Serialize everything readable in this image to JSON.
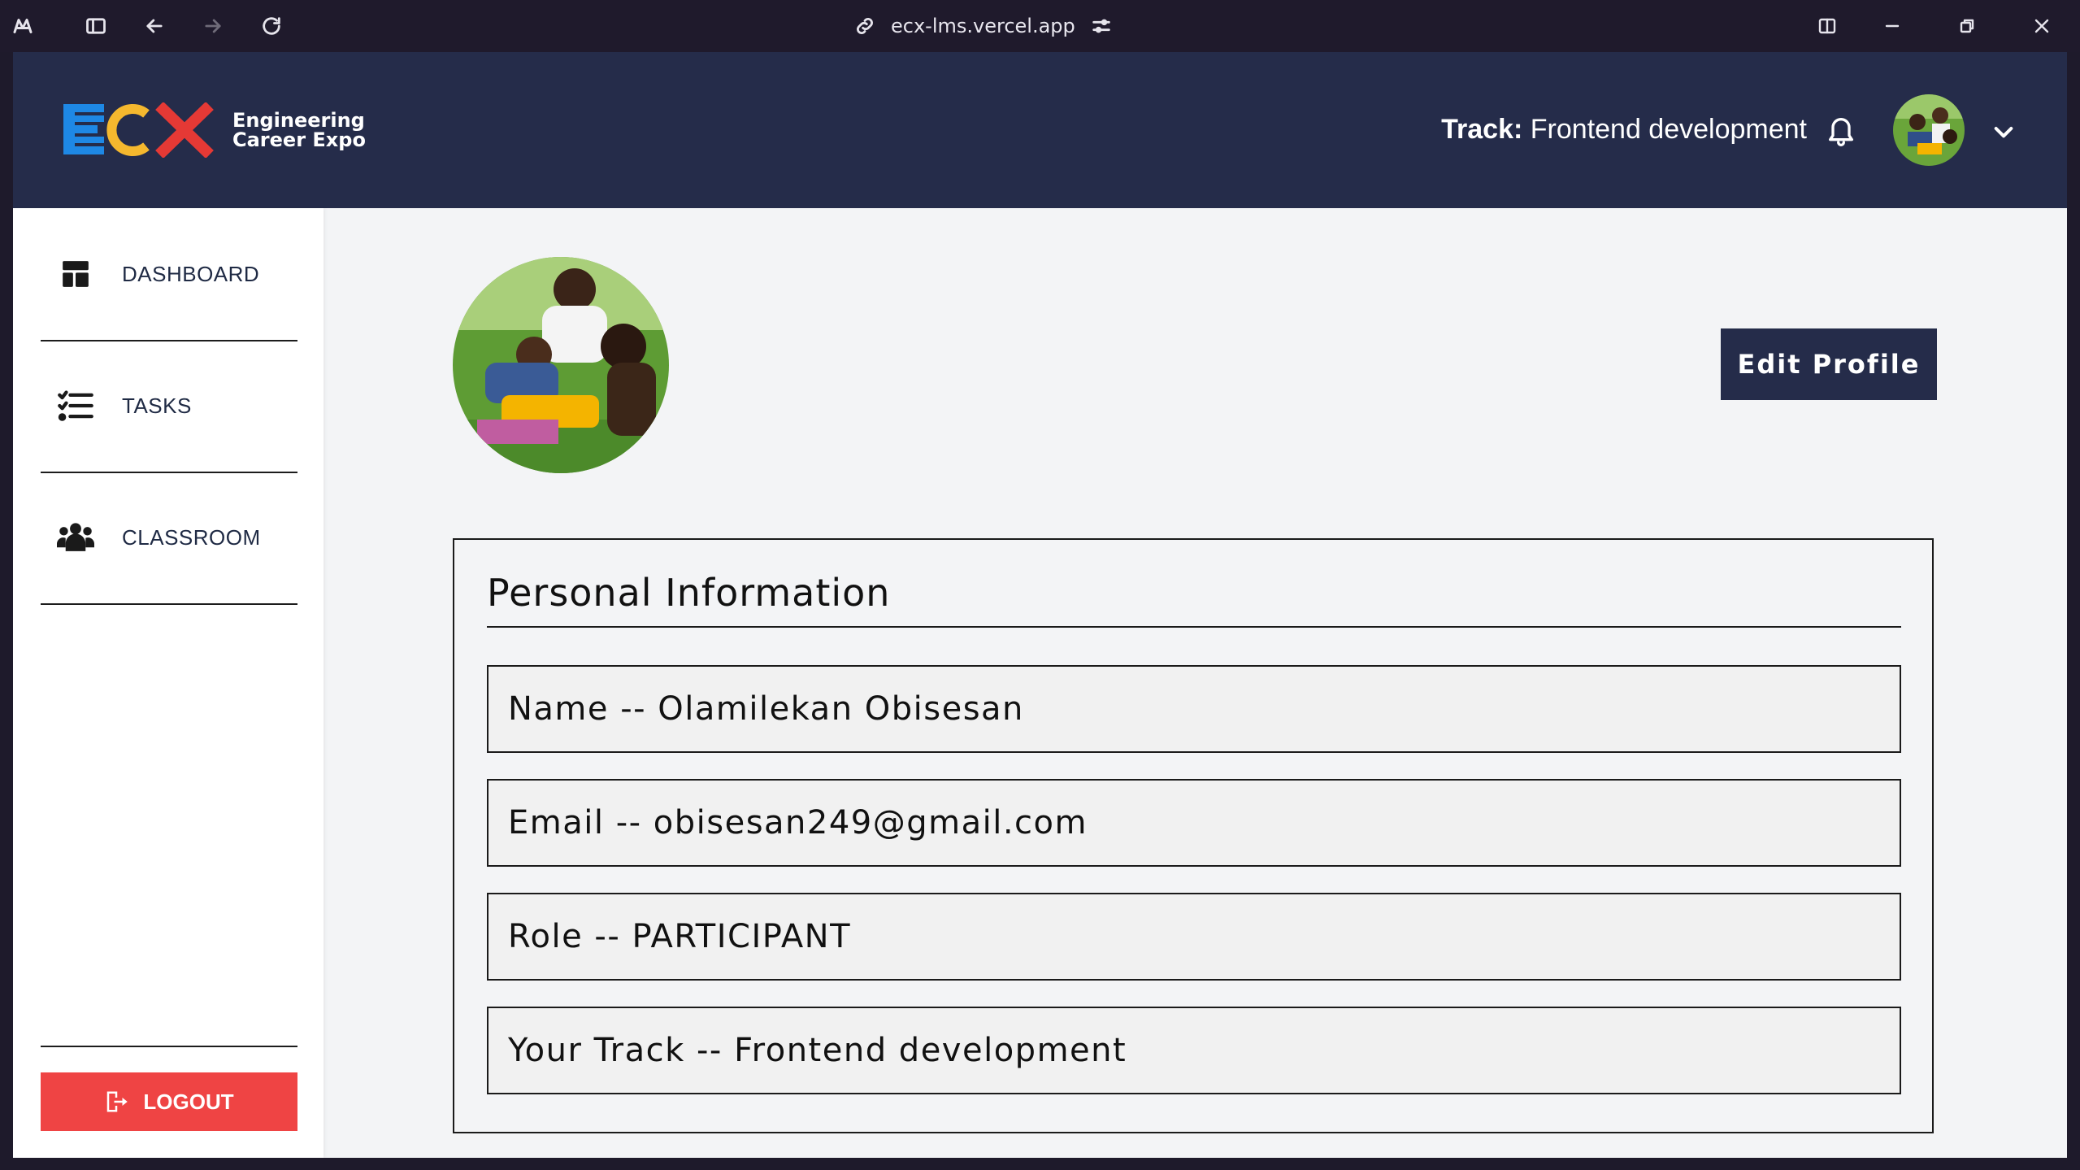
{
  "browser": {
    "url": "ecx-lms.vercel.app"
  },
  "header": {
    "logo_text": "ECX",
    "logo_subtitle_line1": "Engineering",
    "logo_subtitle_line2": "Career Expo",
    "track_label": "Track:",
    "track_value": "Frontend development"
  },
  "sidebar": {
    "items": [
      {
        "label": "DASHBOARD",
        "icon": "dashboard-icon"
      },
      {
        "label": "TASKS",
        "icon": "tasks-icon"
      },
      {
        "label": "CLASSROOM",
        "icon": "classroom-icon"
      }
    ],
    "logout_label": "LOGOUT"
  },
  "main": {
    "edit_button_label": "Edit Profile",
    "card_title": "Personal Information",
    "fields": [
      "Name -- Olamilekan Obisesan",
      "Email -- obisesan249@gmail.com",
      "Role -- PARTICIPANT",
      "Your Track -- Frontend development"
    ]
  },
  "colors": {
    "header_bg": "#252c4a",
    "logout_bg": "#ef4444",
    "logo_blue": "#1e88e5",
    "logo_yellow": "#f5b82e",
    "logo_red": "#e53935"
  }
}
